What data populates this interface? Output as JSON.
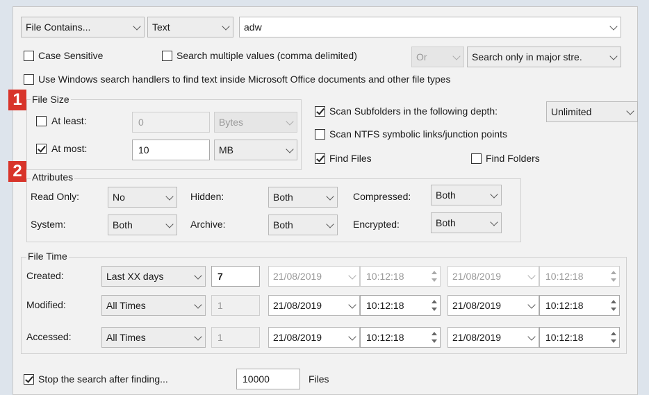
{
  "top": {
    "criteria": "File Contains...",
    "type": "Text",
    "value": "adw"
  },
  "options": {
    "case_sensitive": "Case Sensitive",
    "multi_values": "Search multiple values (comma delimited)",
    "or": "Or",
    "streams": "Search only in major stre.",
    "windows_handlers": "Use Windows search handlers to find text inside Microsoft Office documents and other file types"
  },
  "badges": {
    "b1": "1",
    "b2": "2"
  },
  "file_size": {
    "title": "File Size",
    "at_least": "At least:",
    "at_least_value": "0",
    "at_least_unit": "Bytes",
    "at_most": "At most:",
    "at_most_value": "10",
    "at_most_unit": "MB"
  },
  "scan": {
    "subfolders": "Scan Subfolders in the following depth:",
    "depth": "Unlimited",
    "ntfs": "Scan NTFS symbolic links/junction points",
    "find_files": "Find Files",
    "find_folders": "Find Folders"
  },
  "attributes": {
    "title": "Attributes",
    "read_only": "Read Only:",
    "read_only_val": "No",
    "hidden": "Hidden:",
    "hidden_val": "Both",
    "compressed": "Compressed:",
    "compressed_val": "Both",
    "system": "System:",
    "system_val": "Both",
    "archive": "Archive:",
    "archive_val": "Both",
    "encrypted": "Encrypted:",
    "encrypted_val": "Both"
  },
  "file_time": {
    "title": "File Time",
    "rows": [
      {
        "label": "Created:",
        "mode": "Last XX days",
        "num": "7",
        "d1": "21/08/2019",
        "t1": "10:12:18",
        "d2": "21/08/2019",
        "t2": "10:12:18"
      },
      {
        "label": "Modified:",
        "mode": "All Times",
        "num": "1",
        "d1": "21/08/2019",
        "t1": "10:12:18",
        "d2": "21/08/2019",
        "t2": "10:12:18"
      },
      {
        "label": "Accessed:",
        "mode": "All Times",
        "num": "1",
        "d1": "21/08/2019",
        "t1": "10:12:18",
        "d2": "21/08/2019",
        "t2": "10:12:18"
      }
    ]
  },
  "stop": {
    "label": "Stop the search after finding...",
    "value": "10000",
    "unit": "Files"
  }
}
